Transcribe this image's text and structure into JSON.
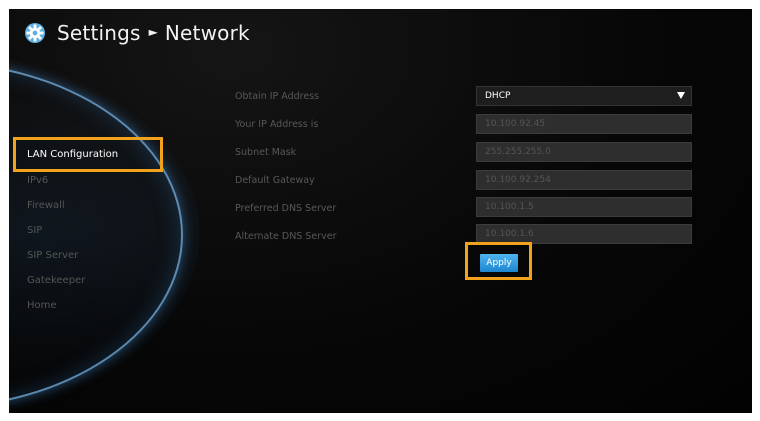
{
  "header": {
    "section": "Settings",
    "separator": "►",
    "page": "Network",
    "icon": "settings-gear-icon"
  },
  "sidebar": {
    "items": [
      {
        "label": "LAN Configuration",
        "active": true
      },
      {
        "label": "IPv6"
      },
      {
        "label": "Firewall"
      },
      {
        "label": "SIP"
      },
      {
        "label": "SIP Server"
      },
      {
        "label": "Gatekeeper"
      },
      {
        "label": "Home"
      }
    ]
  },
  "form": {
    "obtain_ip": {
      "label": "Obtain IP Address",
      "value": "DHCP"
    },
    "ip_address": {
      "label": "Your IP Address is",
      "value": "10.100.92.45"
    },
    "subnet_mask": {
      "label": "Subnet Mask",
      "value": "255.255.255.0"
    },
    "default_gateway": {
      "label": "Default Gateway",
      "value": "10.100.92.254"
    },
    "preferred_dns": {
      "label": "Preferred DNS Server",
      "value": "10.100.1.5"
    },
    "alternate_dns": {
      "label": "Alternate DNS Server",
      "value": "10.100.1.6"
    },
    "apply_label": "Apply"
  },
  "colors": {
    "highlight": "#f2a31b",
    "apply_button": "#2a96dc",
    "background": "#050505",
    "arc": "#78b4e6"
  }
}
